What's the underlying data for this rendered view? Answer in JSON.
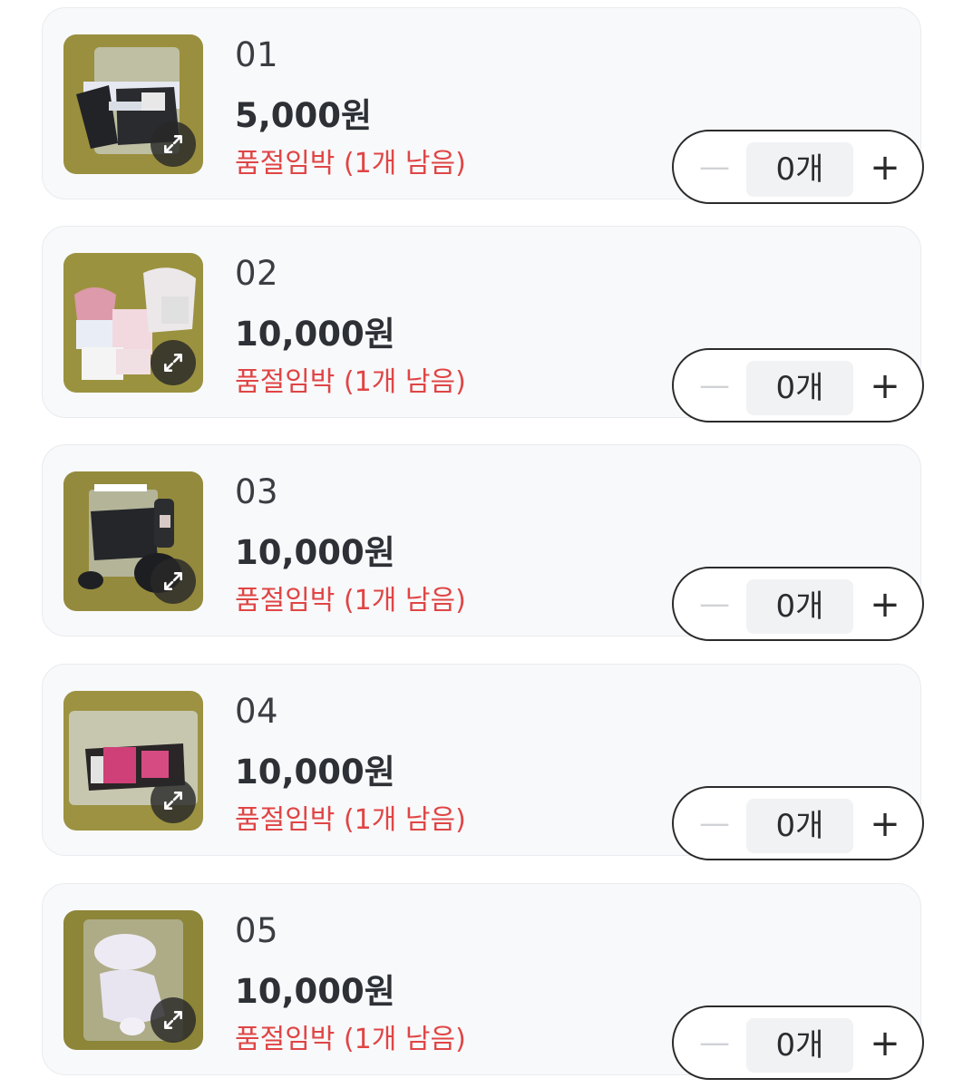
{
  "items": [
    {
      "number": "01",
      "price": "5,000원",
      "stock": "품절임박 (1개 남음)",
      "quantity": "0개",
      "image_icon": "expand-icon"
    },
    {
      "number": "02",
      "price": "10,000원",
      "stock": "품절임박 (1개 남음)",
      "quantity": "0개",
      "image_icon": "expand-icon"
    },
    {
      "number": "03",
      "price": "10,000원",
      "stock": "품절임박 (1개 남음)",
      "quantity": "0개",
      "image_icon": "expand-icon"
    },
    {
      "number": "04",
      "price": "10,000원",
      "stock": "품절임박 (1개 남음)",
      "quantity": "0개",
      "image_icon": "expand-icon"
    },
    {
      "number": "05",
      "price": "10,000원",
      "stock": "품절임박 (1개 남음)",
      "quantity": "0개",
      "image_icon": "expand-icon"
    }
  ],
  "stepper": {
    "minus_symbol": "—",
    "plus_symbol": "+"
  },
  "colors": {
    "stock_warning": "#e04545",
    "card_background": "#f8f9fb",
    "stepper_border": "#2b2b2b"
  }
}
